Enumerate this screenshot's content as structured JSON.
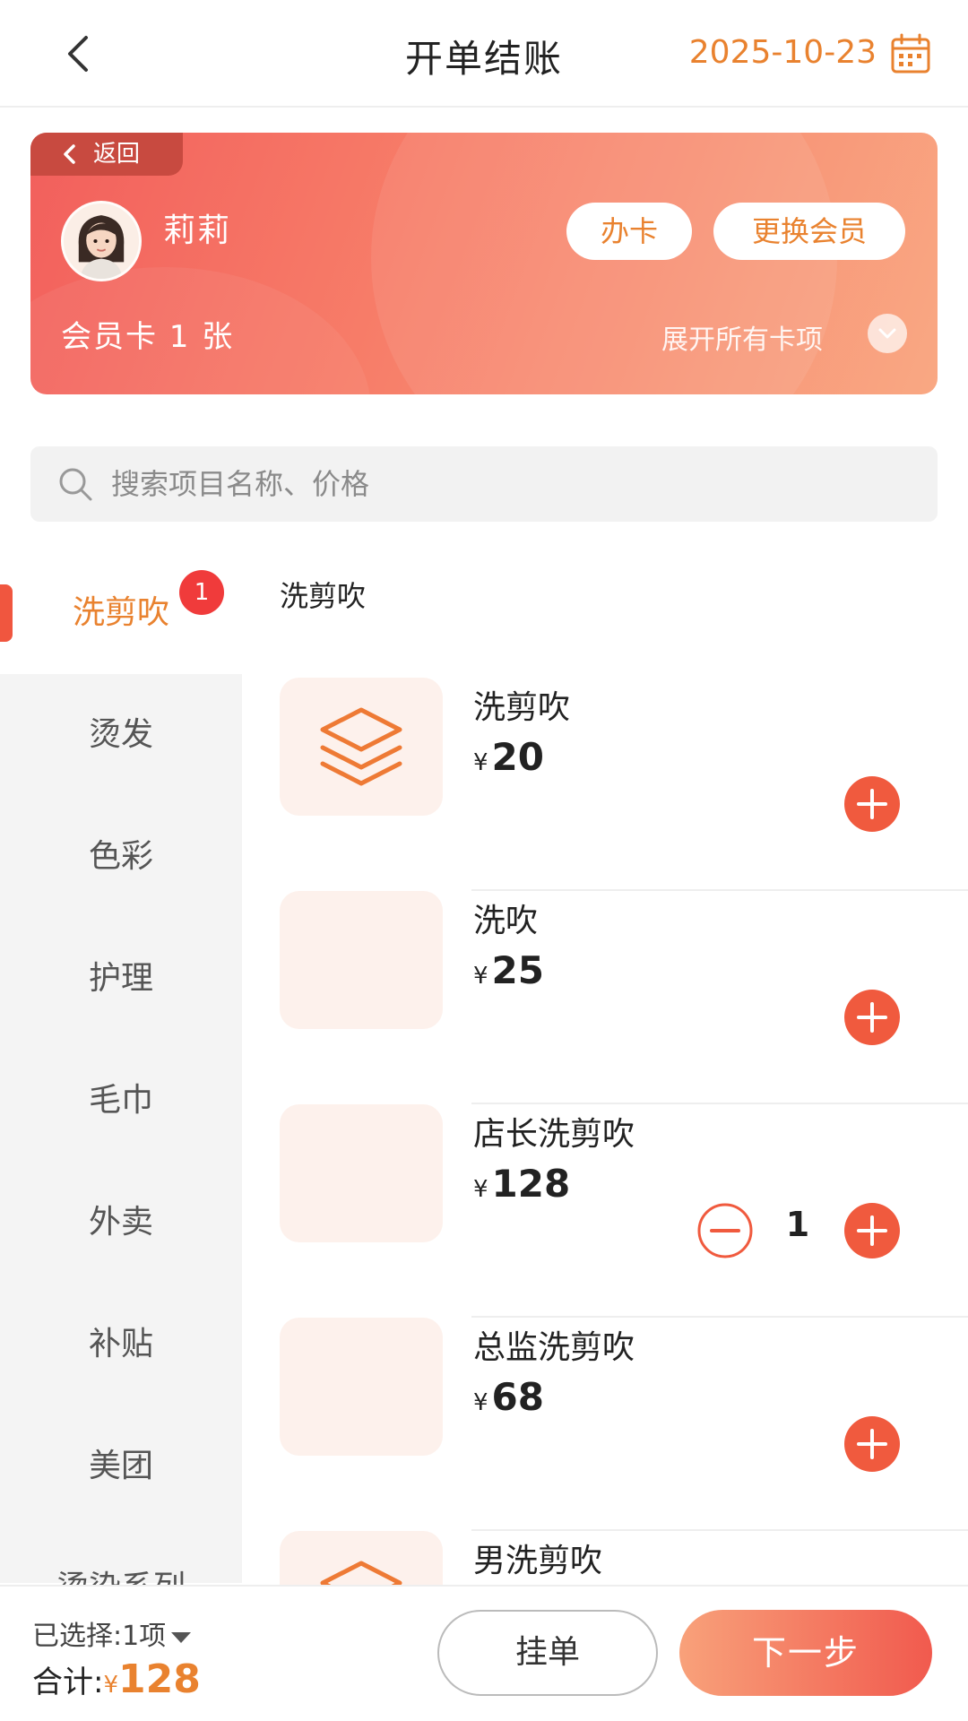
{
  "header": {
    "title": "开单结账",
    "date": "2025-10-23"
  },
  "member_card": {
    "back_label": "返回",
    "member_name": "莉莉",
    "open_card_label": "办卡",
    "change_member_label": "更换会员",
    "card_count_text": "会员卡 1 张",
    "expand_label": "展开所有卡项"
  },
  "search": {
    "placeholder": "搜索项目名称、价格"
  },
  "sidebar": {
    "items": [
      {
        "label": "洗剪吹",
        "badge": "1"
      },
      {
        "label": "烫发"
      },
      {
        "label": "色彩"
      },
      {
        "label": "护理"
      },
      {
        "label": "毛巾"
      },
      {
        "label": "外卖"
      },
      {
        "label": "补贴"
      },
      {
        "label": "美团"
      },
      {
        "label": "烫染系列"
      }
    ]
  },
  "content": {
    "category_title": "洗剪吹",
    "items": [
      {
        "name": "洗剪吹",
        "currency": "¥",
        "price": "20"
      },
      {
        "name": "洗吹",
        "currency": "¥",
        "price": "25"
      },
      {
        "name": "店长洗剪吹",
        "currency": "¥",
        "price": "128",
        "quantity": "1"
      },
      {
        "name": "总监洗剪吹",
        "currency": "¥",
        "price": "68"
      },
      {
        "name": "男洗剪吹"
      }
    ]
  },
  "bottom_bar": {
    "selected_text": "已选择:1项",
    "total_label": "合计:",
    "currency": "¥",
    "total_value": "128",
    "hold_label": "挂单",
    "next_label": "下一步"
  },
  "colors": {
    "accent": "#e9822f",
    "primary_red": "#f0563f",
    "badge": "#f03b3b"
  }
}
